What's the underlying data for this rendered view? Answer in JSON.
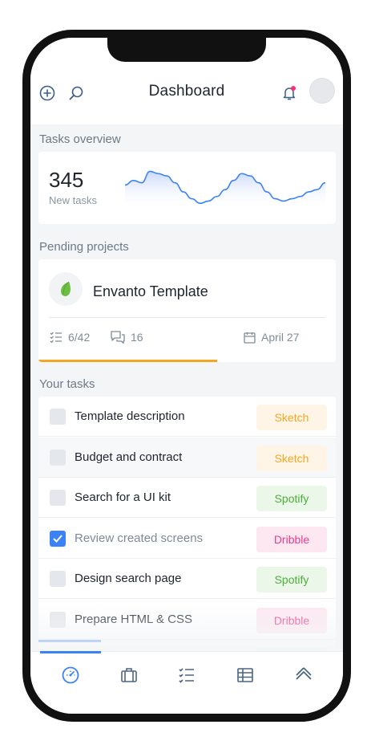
{
  "header": {
    "title": "Dashboard",
    "notification_color": "#ff2d7a",
    "add_icon": "plus-circle-icon",
    "search_icon": "search-icon",
    "bell_icon": "bell-icon"
  },
  "overview": {
    "section_label": "Tasks overview",
    "count": "345",
    "count_label": "New tasks",
    "sparkline": [
      20,
      24,
      22,
      32,
      30,
      28,
      22,
      14,
      8,
      4,
      6,
      10,
      16,
      24,
      30,
      28,
      22,
      14,
      8,
      6,
      8,
      10,
      14,
      16,
      22
    ],
    "accent": "#3b82f6"
  },
  "projects": {
    "section_label": "Pending projects",
    "name": "Envanto Template",
    "tasks": "6/42",
    "comments": "16",
    "date": "April 27",
    "progress": 0.6,
    "progress_color": "#f5a623"
  },
  "tasks": {
    "section_label": "Your tasks",
    "items": [
      {
        "name": "Template description",
        "tag": "Sketch",
        "tag_color": "#f5a623",
        "tag_bg": "#fef5e6",
        "checked": false
      },
      {
        "name": "Budget and contract",
        "tag": "Sketch",
        "tag_color": "#f5a623",
        "tag_bg": "#fef5e6",
        "checked": false
      },
      {
        "name": "Search for a UI kit",
        "tag": "Spotify",
        "tag_color": "#4cae3b",
        "tag_bg": "#ebf7e8",
        "checked": false
      },
      {
        "name": "Review created screens",
        "tag": "Dribble",
        "tag_color": "#ea3d8b",
        "tag_bg": "#fde8f1",
        "checked": true
      },
      {
        "name": "Design search page",
        "tag": "Spotify",
        "tag_color": "#4cae3b",
        "tag_bg": "#ebf7e8",
        "checked": false
      },
      {
        "name": "Prepare HTML & CSS",
        "tag": "Dribble",
        "tag_color": "#ea3d8b",
        "tag_bg": "#fde8f1",
        "checked": false
      }
    ]
  },
  "tabbar": {
    "items": [
      "dashboard-icon",
      "briefcase-icon",
      "checklist-icon",
      "table-icon",
      "chevrons-up-icon"
    ],
    "active": 0
  }
}
